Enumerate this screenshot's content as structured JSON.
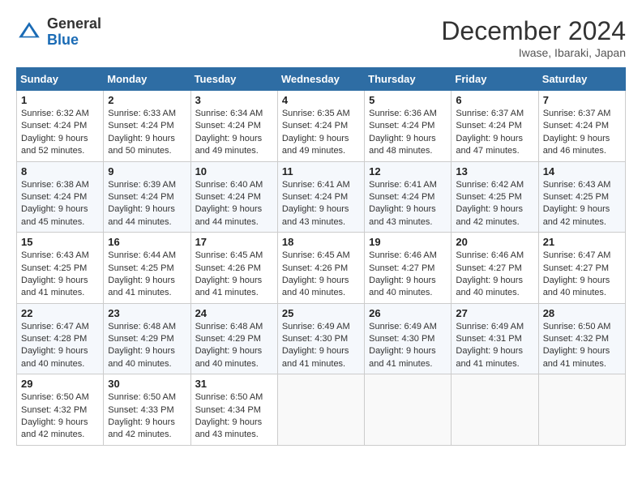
{
  "header": {
    "logo_general": "General",
    "logo_blue": "Blue",
    "title": "December 2024",
    "location": "Iwase, Ibaraki, Japan"
  },
  "days_of_week": [
    "Sunday",
    "Monday",
    "Tuesday",
    "Wednesday",
    "Thursday",
    "Friday",
    "Saturday"
  ],
  "weeks": [
    [
      {
        "day": "1",
        "sunrise": "6:32 AM",
        "sunset": "4:24 PM",
        "daylight": "9 hours and 52 minutes."
      },
      {
        "day": "2",
        "sunrise": "6:33 AM",
        "sunset": "4:24 PM",
        "daylight": "9 hours and 50 minutes."
      },
      {
        "day": "3",
        "sunrise": "6:34 AM",
        "sunset": "4:24 PM",
        "daylight": "9 hours and 49 minutes."
      },
      {
        "day": "4",
        "sunrise": "6:35 AM",
        "sunset": "4:24 PM",
        "daylight": "9 hours and 49 minutes."
      },
      {
        "day": "5",
        "sunrise": "6:36 AM",
        "sunset": "4:24 PM",
        "daylight": "9 hours and 48 minutes."
      },
      {
        "day": "6",
        "sunrise": "6:37 AM",
        "sunset": "4:24 PM",
        "daylight": "9 hours and 47 minutes."
      },
      {
        "day": "7",
        "sunrise": "6:37 AM",
        "sunset": "4:24 PM",
        "daylight": "9 hours and 46 minutes."
      }
    ],
    [
      {
        "day": "8",
        "sunrise": "6:38 AM",
        "sunset": "4:24 PM",
        "daylight": "9 hours and 45 minutes."
      },
      {
        "day": "9",
        "sunrise": "6:39 AM",
        "sunset": "4:24 PM",
        "daylight": "9 hours and 44 minutes."
      },
      {
        "day": "10",
        "sunrise": "6:40 AM",
        "sunset": "4:24 PM",
        "daylight": "9 hours and 44 minutes."
      },
      {
        "day": "11",
        "sunrise": "6:41 AM",
        "sunset": "4:24 PM",
        "daylight": "9 hours and 43 minutes."
      },
      {
        "day": "12",
        "sunrise": "6:41 AM",
        "sunset": "4:24 PM",
        "daylight": "9 hours and 43 minutes."
      },
      {
        "day": "13",
        "sunrise": "6:42 AM",
        "sunset": "4:25 PM",
        "daylight": "9 hours and 42 minutes."
      },
      {
        "day": "14",
        "sunrise": "6:43 AM",
        "sunset": "4:25 PM",
        "daylight": "9 hours and 42 minutes."
      }
    ],
    [
      {
        "day": "15",
        "sunrise": "6:43 AM",
        "sunset": "4:25 PM",
        "daylight": "9 hours and 41 minutes."
      },
      {
        "day": "16",
        "sunrise": "6:44 AM",
        "sunset": "4:25 PM",
        "daylight": "9 hours and 41 minutes."
      },
      {
        "day": "17",
        "sunrise": "6:45 AM",
        "sunset": "4:26 PM",
        "daylight": "9 hours and 41 minutes."
      },
      {
        "day": "18",
        "sunrise": "6:45 AM",
        "sunset": "4:26 PM",
        "daylight": "9 hours and 40 minutes."
      },
      {
        "day": "19",
        "sunrise": "6:46 AM",
        "sunset": "4:27 PM",
        "daylight": "9 hours and 40 minutes."
      },
      {
        "day": "20",
        "sunrise": "6:46 AM",
        "sunset": "4:27 PM",
        "daylight": "9 hours and 40 minutes."
      },
      {
        "day": "21",
        "sunrise": "6:47 AM",
        "sunset": "4:27 PM",
        "daylight": "9 hours and 40 minutes."
      }
    ],
    [
      {
        "day": "22",
        "sunrise": "6:47 AM",
        "sunset": "4:28 PM",
        "daylight": "9 hours and 40 minutes."
      },
      {
        "day": "23",
        "sunrise": "6:48 AM",
        "sunset": "4:29 PM",
        "daylight": "9 hours and 40 minutes."
      },
      {
        "day": "24",
        "sunrise": "6:48 AM",
        "sunset": "4:29 PM",
        "daylight": "9 hours and 40 minutes."
      },
      {
        "day": "25",
        "sunrise": "6:49 AM",
        "sunset": "4:30 PM",
        "daylight": "9 hours and 41 minutes."
      },
      {
        "day": "26",
        "sunrise": "6:49 AM",
        "sunset": "4:30 PM",
        "daylight": "9 hours and 41 minutes."
      },
      {
        "day": "27",
        "sunrise": "6:49 AM",
        "sunset": "4:31 PM",
        "daylight": "9 hours and 41 minutes."
      },
      {
        "day": "28",
        "sunrise": "6:50 AM",
        "sunset": "4:32 PM",
        "daylight": "9 hours and 41 minutes."
      }
    ],
    [
      {
        "day": "29",
        "sunrise": "6:50 AM",
        "sunset": "4:32 PM",
        "daylight": "9 hours and 42 minutes."
      },
      {
        "day": "30",
        "sunrise": "6:50 AM",
        "sunset": "4:33 PM",
        "daylight": "9 hours and 42 minutes."
      },
      {
        "day": "31",
        "sunrise": "6:50 AM",
        "sunset": "4:34 PM",
        "daylight": "9 hours and 43 minutes."
      },
      null,
      null,
      null,
      null
    ]
  ]
}
